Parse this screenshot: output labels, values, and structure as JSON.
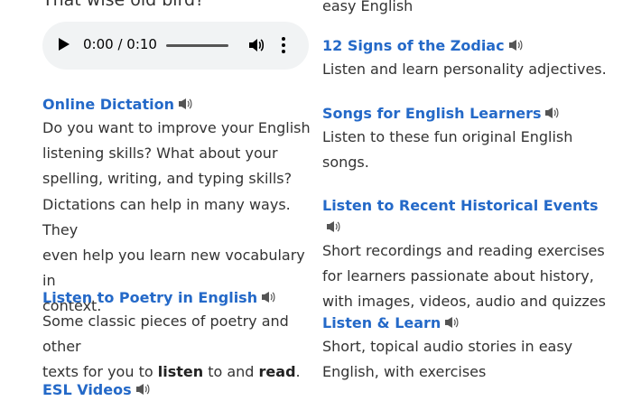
{
  "left": {
    "poem_tail": "That wise old bird?",
    "audio": {
      "time": "0:00 / 0:10",
      "progress": 0
    },
    "entries": [
      {
        "title": "Online Dictation",
        "lines": [
          "Do you want to improve your English",
          "listening skills? What about your",
          "spelling, writing, and typing skills?",
          "Dictations can help in many ways. They",
          "even help you learn new vocabulary in",
          "context."
        ]
      },
      {
        "title": "Listen to Poetry in English",
        "line1": "Some classic pieces of poetry and other",
        "line2_pre": "texts for you to ",
        "line2_b1": "listen",
        "line2_mid": " to and ",
        "line2_b2": "read",
        "line2_post": "."
      },
      {
        "title": "ESL Videos"
      }
    ]
  },
  "right": {
    "top_tail": "easy English",
    "entries": [
      {
        "title": "12 Signs of the Zodiac",
        "lines": [
          "Listen and learn personality adjectives."
        ]
      },
      {
        "title": "Songs for English Learners",
        "lines": [
          "Listen to these fun original English",
          "songs."
        ]
      },
      {
        "title": "Listen to Recent Historical Events",
        "lines": [
          "Short recordings and reading exercises",
          "for learners passionate about history,",
          "with images, videos, audio and quizzes"
        ]
      },
      {
        "title": "Listen & Learn",
        "lines": [
          "Short, topical audio stories in easy",
          "English, with exercises"
        ]
      }
    ]
  },
  "icons": {
    "speaker": "speaker-icon",
    "play": "play-icon",
    "volume": "volume-icon",
    "more": "more-options-icon"
  },
  "colors": {
    "link": "#2469c8",
    "text": "#333333",
    "player_bg": "#f1f3f4"
  }
}
